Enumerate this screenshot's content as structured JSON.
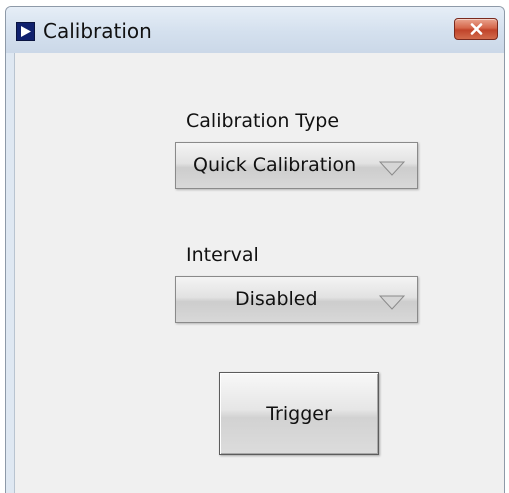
{
  "window": {
    "title": "Calibration",
    "close_label": "Close"
  },
  "calibration_type": {
    "label": "Calibration Type",
    "selected": "Quick Calibration"
  },
  "interval": {
    "label": "Interval",
    "selected": "Disabled"
  },
  "trigger": {
    "label": "Trigger"
  },
  "icons": {
    "app": "play-triangle-icon",
    "close": "close-x-icon",
    "dropdown": "dropdown-triangle-icon"
  },
  "colors": {
    "close_button": "#c9502f",
    "app_icon": "#10216e",
    "client_background": "#f0f0f0"
  }
}
